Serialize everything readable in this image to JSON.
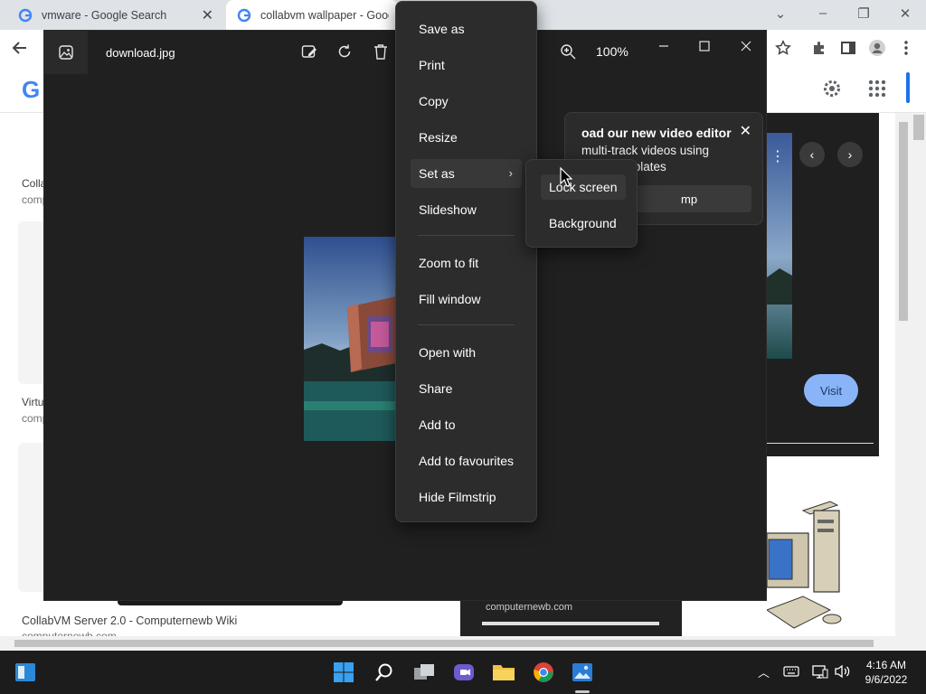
{
  "browser": {
    "tabs": [
      {
        "title": "vmware - Google Search",
        "icon": "google-icon"
      },
      {
        "title": "collabvm wallpaper - Google",
        "icon": "google-icon"
      }
    ],
    "logo_letter": "G"
  },
  "results": {
    "left_snippets": [
      "Colla",
      "comp",
      "Virtu",
      "comp"
    ],
    "bottom_title": "CollabVM Server 2.0 - Computernewb Wiki",
    "bottom_sub": "computernewb.com",
    "comp_tag": "computernewb.com",
    "visit_label": "Visit"
  },
  "photos": {
    "filename": "download.jpg",
    "zoom": "100%",
    "promo": {
      "title": "oad our new video editor",
      "line1": "multi-track videos using",
      "line2": "uality templates",
      "button": "mp"
    }
  },
  "context_menu": {
    "items": [
      {
        "label": "Save as"
      },
      {
        "label": "Print"
      },
      {
        "label": "Copy"
      },
      {
        "label": "Resize"
      },
      {
        "label": "Set as",
        "has_submenu": true
      },
      {
        "label": "Slideshow"
      },
      {
        "label": "Zoom to fit"
      },
      {
        "label": "Fill window"
      },
      {
        "label": "Open with"
      },
      {
        "label": "Share"
      },
      {
        "label": "Add to"
      },
      {
        "label": "Add to favourites"
      },
      {
        "label": "Hide Filmstrip"
      }
    ],
    "submenu": [
      "Lock screen",
      "Background"
    ]
  },
  "taskbar": {
    "time": "4:16 AM",
    "date": "9/6/2022"
  },
  "colors": {
    "photos_bg": "#202020",
    "menu_bg": "#2c2c2c",
    "accent_blue": "#8ab4f8",
    "taskbar_bg": "#1c1c1c"
  }
}
